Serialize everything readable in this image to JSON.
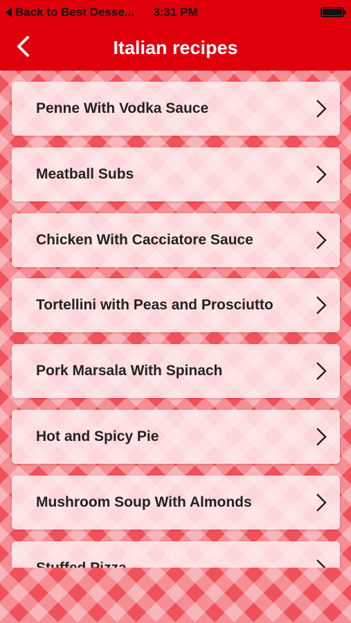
{
  "status_bar": {
    "back_text": "Back to Best Desse...",
    "time": "3:31 PM"
  },
  "nav": {
    "title": "Italian recipes",
    "back_icon": "chevron-left-icon"
  },
  "recipes": [
    {
      "label": "Penne With Vodka Sauce"
    },
    {
      "label": "Meatball Subs"
    },
    {
      "label": "Chicken With Cacciatore Sauce"
    },
    {
      "label": "Tortellini with Peas and Prosciutto"
    },
    {
      "label": "Pork Marsala With Spinach"
    },
    {
      "label": "Hot and Spicy Pie"
    },
    {
      "label": "Mushroom Soup With Almonds"
    },
    {
      "label": "Stuffed Pizza"
    }
  ],
  "colors": {
    "bar_red": "#e0000b",
    "title_white": "#ffffff",
    "tablecloth_red": "#f0525c"
  }
}
